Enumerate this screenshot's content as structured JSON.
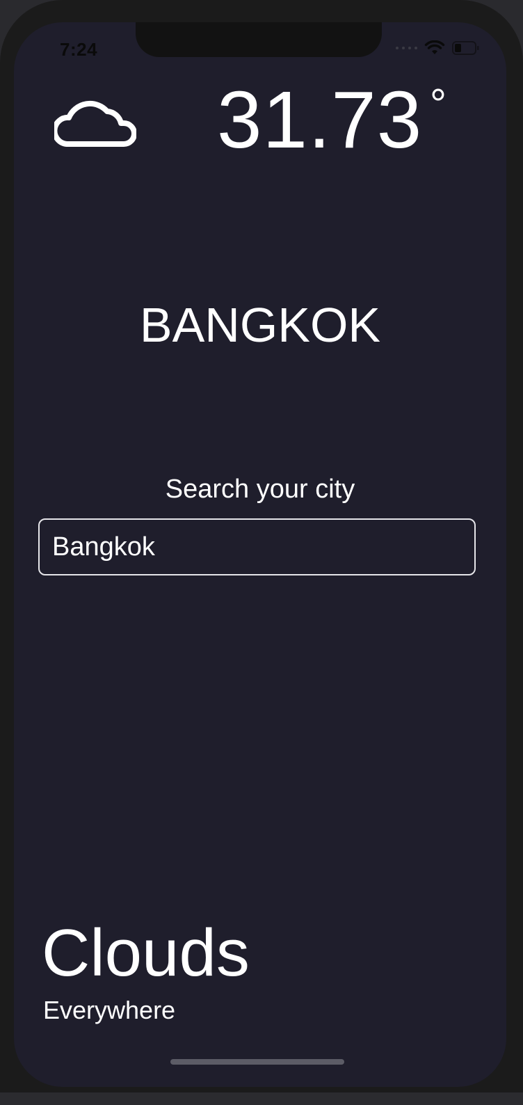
{
  "status_bar": {
    "time": "7:24",
    "icons": [
      "cellular-dots-icon",
      "wifi-icon",
      "battery-icon"
    ]
  },
  "weather": {
    "icon": "cloud-icon",
    "temperature": "31.73",
    "degree_symbol": "°",
    "city": "BANGKOK",
    "condition": "Clouds",
    "description": "Everywhere"
  },
  "search": {
    "label": "Search your city",
    "value": "Bangkok"
  },
  "colors": {
    "background": "#1f1e2c",
    "text": "#ffffff",
    "input_border": "#e6e6ea"
  }
}
